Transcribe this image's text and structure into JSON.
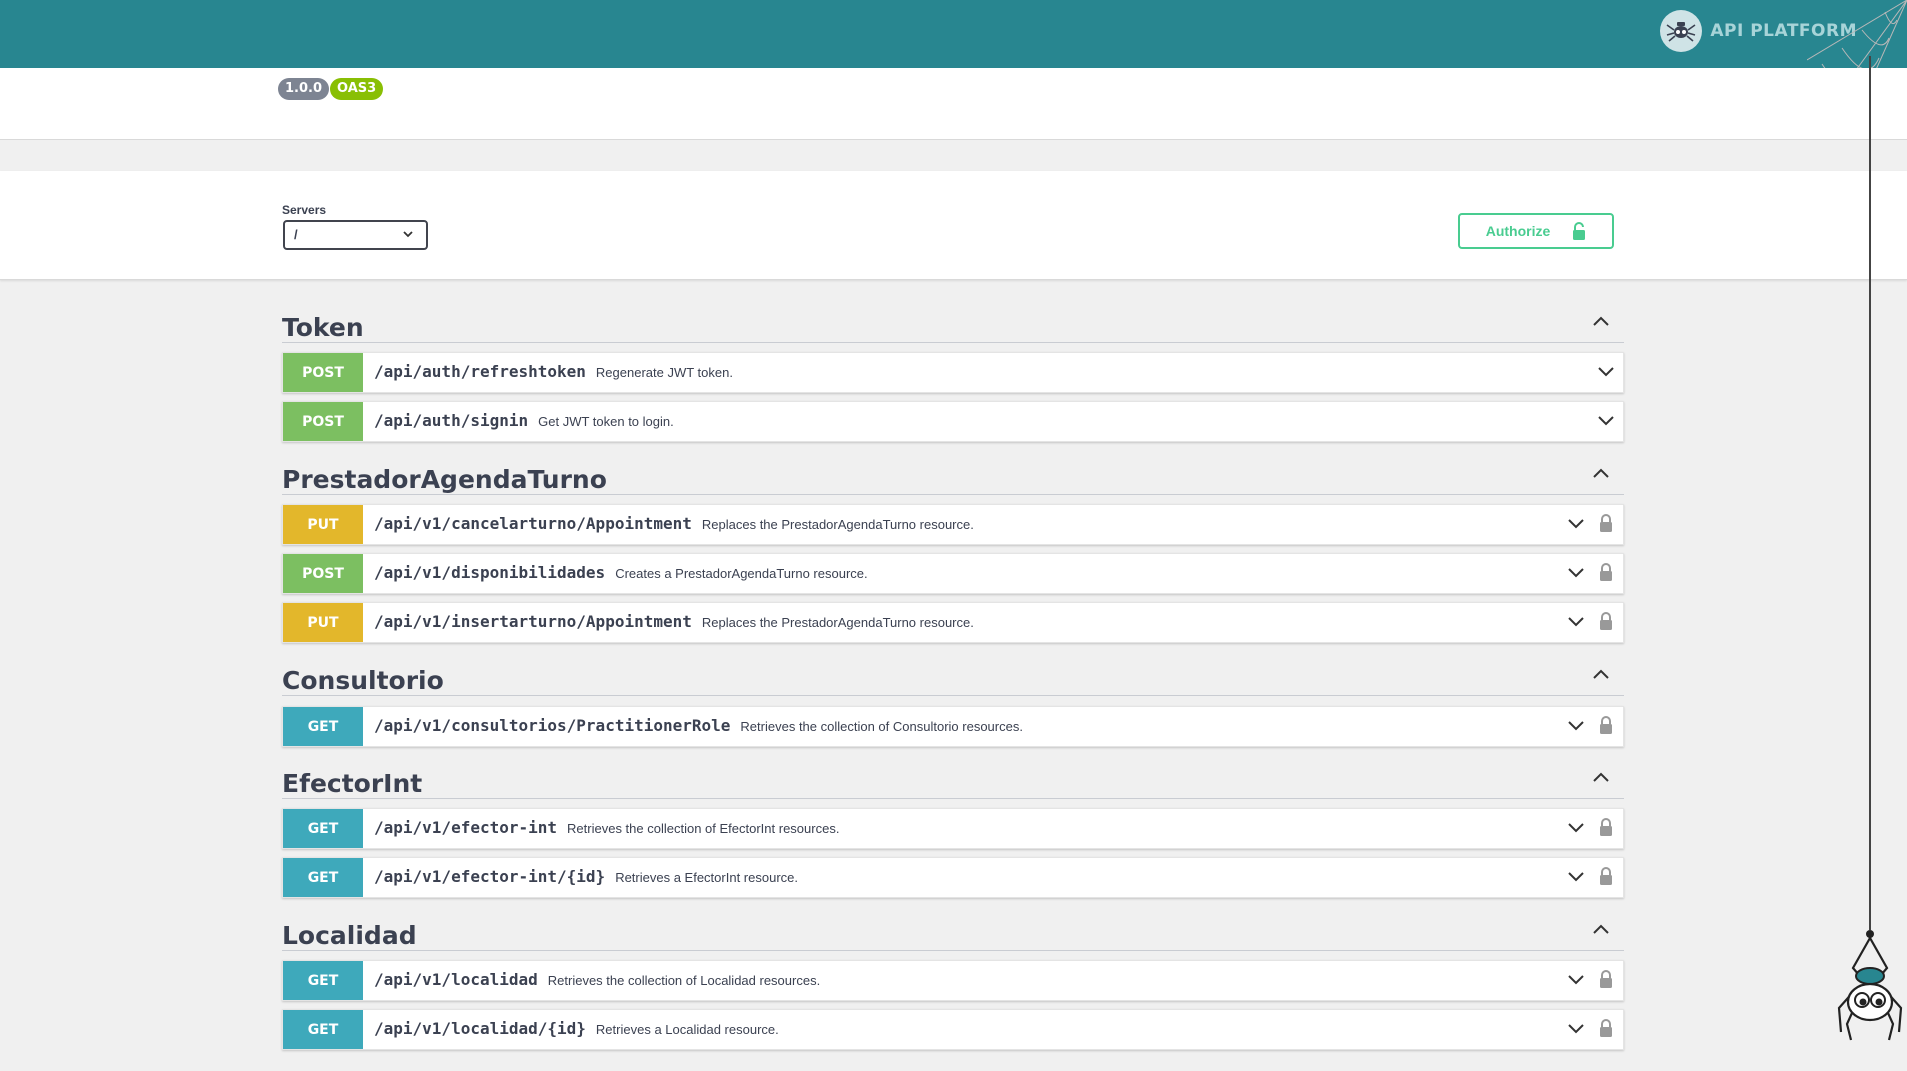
{
  "header": {
    "logo_text": "API PLATFORM",
    "logo_icon": "spider-logo-icon"
  },
  "info": {
    "version": "1.0.0",
    "spec": "OAS3"
  },
  "servers": {
    "label": "Servers",
    "selected": "/"
  },
  "authorize": {
    "label": "Authorize",
    "icon": "unlocked-icon"
  },
  "colors": {
    "post": "#7cbf61",
    "put": "#e3b72b",
    "get": "#3ea9bb",
    "topbar": "#288690",
    "authorize": "#49cc90"
  },
  "tags": [
    {
      "name": "Token",
      "ops": [
        {
          "method": "POST",
          "path": "/api/auth/refreshtoken",
          "summary": "Regenerate JWT token."
        },
        {
          "method": "POST",
          "path": "/api/auth/signin",
          "summary": "Get JWT token to login."
        }
      ]
    },
    {
      "name": "PrestadorAgendaTurno",
      "ops": [
        {
          "method": "PUT",
          "path": "/api/v1/cancelarturno/Appointment",
          "summary": "Replaces the PrestadorAgendaTurno resource."
        },
        {
          "method": "POST",
          "path": "/api/v1/disponibilidades",
          "summary": "Creates a PrestadorAgendaTurno resource."
        },
        {
          "method": "PUT",
          "path": "/api/v1/insertarturno/Appointment",
          "summary": "Replaces the PrestadorAgendaTurno resource."
        }
      ]
    },
    {
      "name": "Consultorio",
      "ops": [
        {
          "method": "GET",
          "path": "/api/v1/consultorios/PractitionerRole",
          "summary": "Retrieves the collection of Consultorio resources."
        }
      ]
    },
    {
      "name": "EfectorInt",
      "ops": [
        {
          "method": "GET",
          "path": "/api/v1/efector-int",
          "summary": "Retrieves the collection of EfectorInt resources."
        },
        {
          "method": "GET",
          "path": "/api/v1/efector-int/{id}",
          "summary": "Retrieves a EfectorInt resource."
        }
      ]
    },
    {
      "name": "Localidad",
      "ops": [
        {
          "method": "GET",
          "path": "/api/v1/localidad",
          "summary": "Retrieves the collection of Localidad resources."
        },
        {
          "method": "GET",
          "path": "/api/v1/localidad/{id}",
          "summary": "Retrieves a Localidad resource."
        }
      ]
    }
  ]
}
